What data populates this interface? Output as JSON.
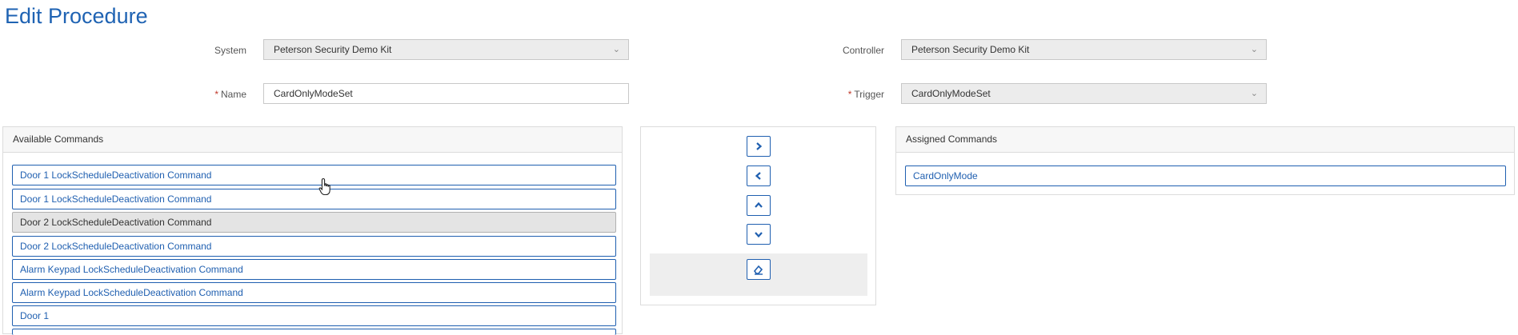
{
  "page": {
    "title": "Edit Procedure"
  },
  "form": {
    "system": {
      "label": "System",
      "value": "Peterson Security Demo Kit"
    },
    "controller": {
      "label": "Controller",
      "value": "Peterson Security Demo Kit"
    },
    "name": {
      "required_mark": "*",
      "label": "Name",
      "value": "CardOnlyModeSet"
    },
    "trigger": {
      "required_mark": "*",
      "label": "Trigger",
      "value": "CardOnlyModeSet"
    }
  },
  "available": {
    "header": "Available Commands",
    "items": [
      {
        "label": "Door 1 LockScheduleDeactivation Command",
        "selected": false
      },
      {
        "label": "Door 1 LockScheduleDeactivation Command",
        "selected": false
      },
      {
        "label": "Door 2 LockScheduleDeactivation Command",
        "selected": true
      },
      {
        "label": "Door 2 LockScheduleDeactivation Command",
        "selected": false
      },
      {
        "label": "Alarm Keypad LockScheduleDeactivation Command",
        "selected": false
      },
      {
        "label": "Alarm Keypad LockScheduleDeactivation Command",
        "selected": false
      },
      {
        "label": "Door 1",
        "selected": false
      }
    ]
  },
  "controls": {
    "icons": [
      "chevron-right-icon",
      "chevron-left-icon",
      "chevron-up-icon",
      "chevron-down-icon",
      "eraser-icon"
    ]
  },
  "assigned": {
    "header": "Assigned Commands",
    "items": [
      {
        "label": "CardOnlyMode"
      }
    ]
  },
  "colors": {
    "accent": "#1f5fb0",
    "title": "#1f63b3",
    "selected_bg": "#e4e4e4"
  }
}
